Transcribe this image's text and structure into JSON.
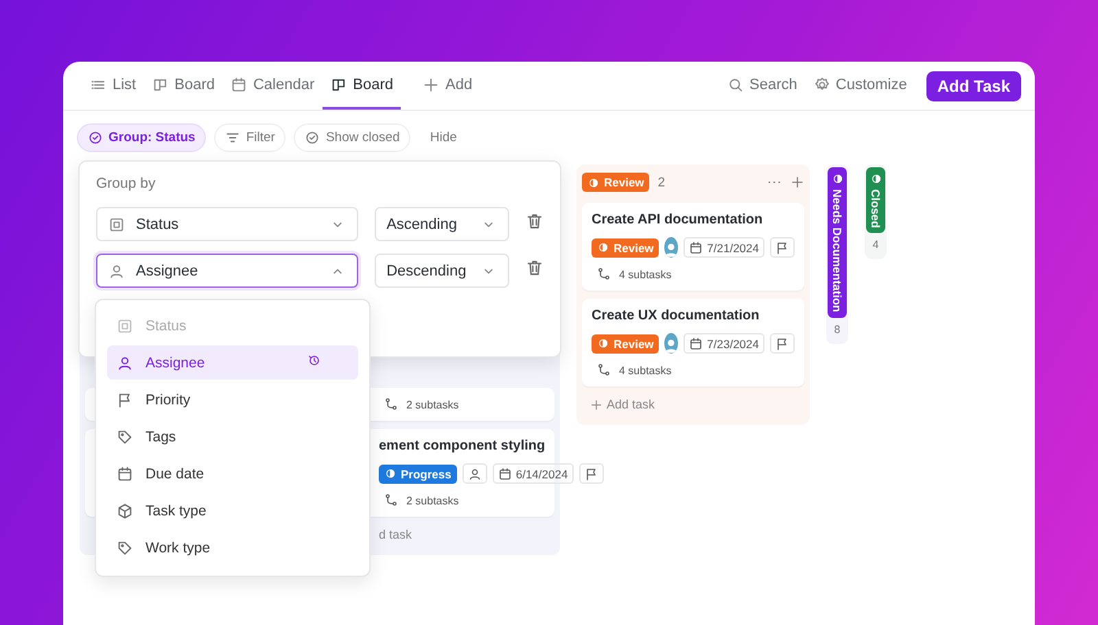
{
  "tabs": [
    {
      "label": "List",
      "kind": "list",
      "selected": false
    },
    {
      "label": "Board",
      "kind": "board",
      "selected": false
    },
    {
      "label": "Calendar",
      "kind": "calendar",
      "selected": false
    },
    {
      "label": "Board",
      "kind": "board",
      "selected": true
    }
  ],
  "add_view": "Add",
  "header_actions": [
    {
      "label": "Search",
      "kind": "search"
    },
    {
      "label": "Customize",
      "kind": "gear"
    }
  ],
  "add_task_button": "Add Task",
  "toolbar": [
    {
      "label": "Group: Status",
      "kind": "check-circle",
      "active": true
    },
    {
      "label": "Filter",
      "kind": "filter",
      "active": false
    },
    {
      "label": "Show closed",
      "kind": "check-circle",
      "active": false
    },
    {
      "label": "Hide",
      "kind": "plain",
      "active": false
    }
  ],
  "in_progress_column": {
    "cards": [
      {
        "subtasks": "2 subtasks"
      },
      {
        "title": "ement component styling",
        "status": "Progress",
        "date": "6/14/2024",
        "subtasks": "2 subtasks"
      }
    ],
    "add_label": "d task"
  },
  "review_column": {
    "status": "Review",
    "color": "#f26a1f",
    "count": "2",
    "cards": [
      {
        "title": "Create API documentation",
        "status": "Review",
        "date": "7/21/2024",
        "subtasks": "4 subtasks"
      },
      {
        "title": "Create UX documentation",
        "status": "Review",
        "date": "7/23/2024",
        "subtasks": "4 subtasks"
      }
    ],
    "add_label": "Add task"
  },
  "collapsed_columns": [
    {
      "name": "Needs Documentation",
      "color": "#7b1fe0",
      "count": "8"
    },
    {
      "name": "Closed",
      "color": "#1f8f52",
      "count": "4"
    }
  ],
  "group_by": {
    "title": "Group by",
    "rows": [
      {
        "field": "Status",
        "kind": "status",
        "open": false,
        "order": "Ascending"
      },
      {
        "field": "Assignee",
        "kind": "person",
        "open": true,
        "order": "Descending"
      }
    ]
  },
  "field_menu": [
    {
      "label": "Status",
      "kind": "status",
      "disabled": true,
      "selected": false
    },
    {
      "label": "Assignee",
      "kind": "person",
      "disabled": false,
      "selected": true
    },
    {
      "label": "Priority",
      "kind": "flag",
      "disabled": false,
      "selected": false
    },
    {
      "label": "Tags",
      "kind": "tag",
      "disabled": false,
      "selected": false
    },
    {
      "label": "Due date",
      "kind": "calendar",
      "disabled": false,
      "selected": false
    },
    {
      "label": "Task type",
      "kind": "cube",
      "disabled": false,
      "selected": false
    },
    {
      "label": "Work type",
      "kind": "tag",
      "disabled": false,
      "selected": false
    }
  ]
}
